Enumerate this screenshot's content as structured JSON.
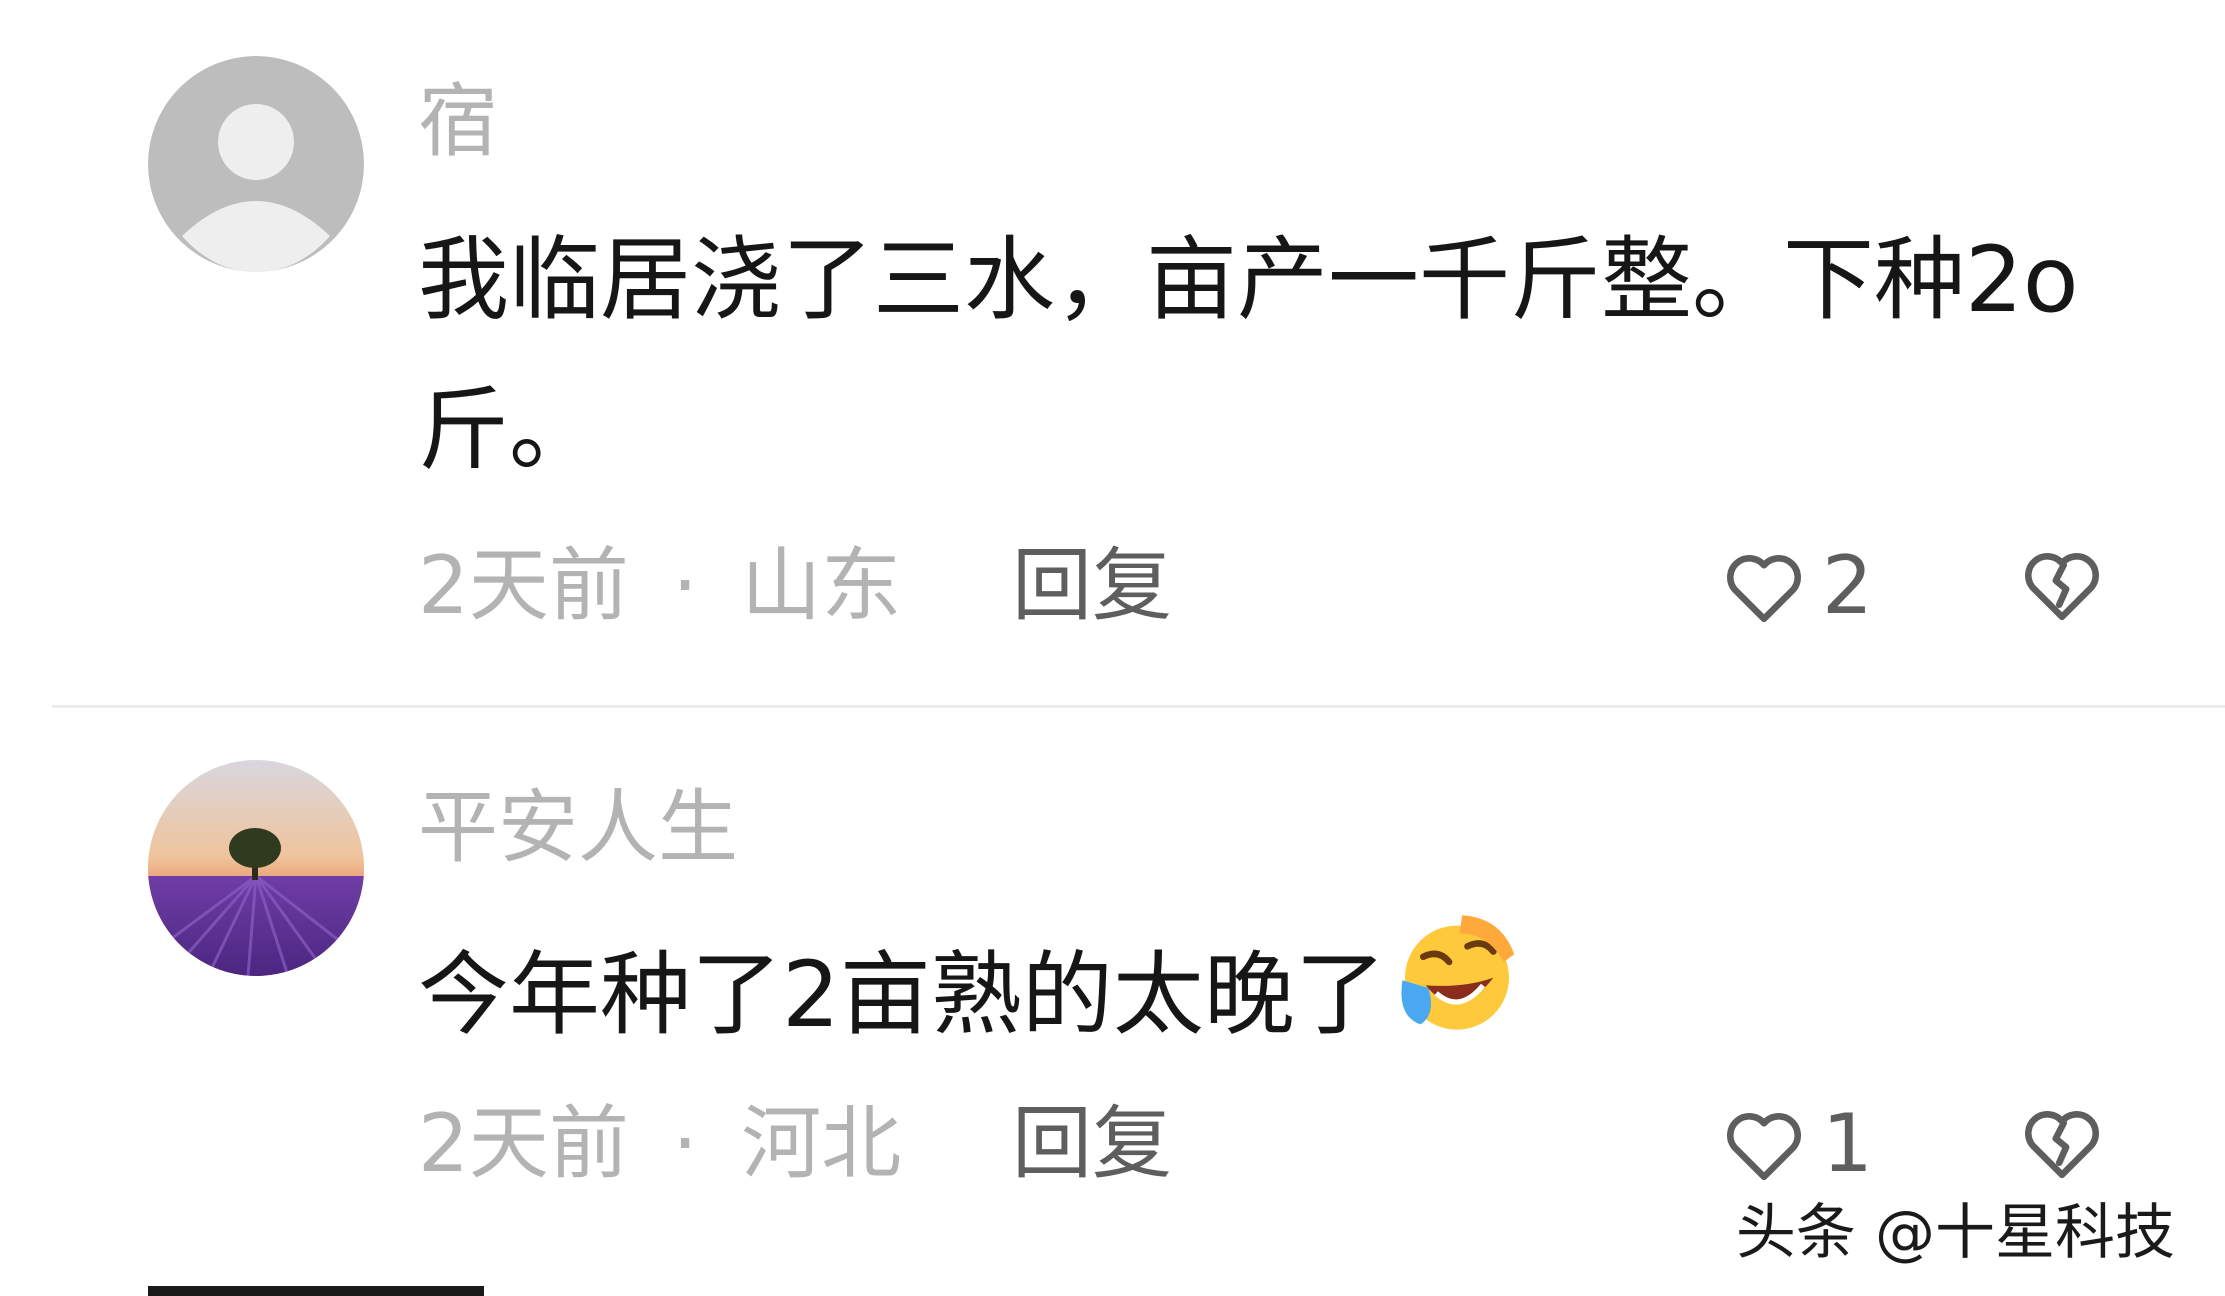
{
  "comments": [
    {
      "username": "宿",
      "text": "我临居浇了三水，亩产一千斤整。下种2o斤。",
      "time": "2天前",
      "separator": "·",
      "location": "山东",
      "reply_label": "回复",
      "likes": "2",
      "avatar": "default-avatar-icon"
    },
    {
      "username": "平安人生",
      "text": "今年种了2亩熟的太晚了",
      "emoji": "rofl-emoji",
      "time": "2天前",
      "separator": "·",
      "location": "河北",
      "reply_label": "回复",
      "likes": "1",
      "avatar": "lavender-field-avatar"
    }
  ],
  "watermark": "头条 @十星科技",
  "colors": {
    "username": "#b3b3b3",
    "text": "#161616",
    "meta": "#b3b3b3",
    "action": "#5e5e5e",
    "divider": "#ececec"
  }
}
